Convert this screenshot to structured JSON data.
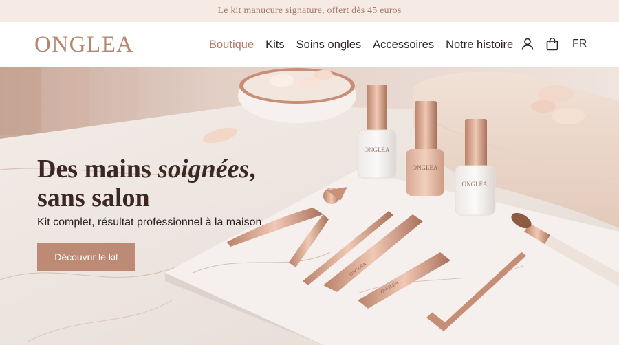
{
  "announcement": {
    "text": "Le kit manucure signature, offert dès 45 euros"
  },
  "brand": {
    "logo": "ONGLEA"
  },
  "nav": {
    "items": [
      {
        "label": "Boutique",
        "active": true
      },
      {
        "label": "Kits"
      },
      {
        "label": "Soins ongles"
      },
      {
        "label": "Accessoires"
      },
      {
        "label": "Notre histoire"
      }
    ]
  },
  "header_icons": {
    "account": "user-icon",
    "cart": "shopping-bag-icon",
    "language": "FR"
  },
  "hero": {
    "title_part1": "Des mains ",
    "title_em": "soignées",
    "title_part2": ",",
    "title_line2": "sans salon",
    "subtitle": "Kit complet, résultat professionnel à la maison",
    "cta_label": "Découvrir le kit",
    "bottle_label": "ONGLEA",
    "tool_label": "ONGLEA"
  },
  "colors": {
    "accent": "#bd8a76",
    "brand": "#b68670",
    "text": "#2d2422",
    "announce_bg": "#f6ebe4"
  }
}
